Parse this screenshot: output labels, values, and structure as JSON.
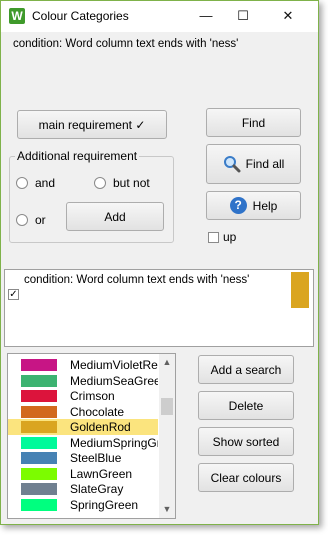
{
  "window": {
    "title": "Colour Categories",
    "app_icon_letter": "W",
    "minimize_glyph": "—",
    "maximize_glyph": "☐",
    "close_glyph": "✕"
  },
  "top_condition": "condition: Word column text ends with 'ness'",
  "buttons": {
    "main_requirement": "main  requirement ✓",
    "find": "Find",
    "find_all": "Find all",
    "help": "Help",
    "add": "Add",
    "add_search": "Add a search",
    "delete": "Delete",
    "show_sorted": "Show sorted",
    "clear_colours": "Clear colours"
  },
  "additional_requirement": {
    "label": "Additional requirement",
    "and": "and",
    "but_not": "but not",
    "or": "or"
  },
  "up_label": "up",
  "search_item": {
    "text": "condition: Word column text ends with 'ness'",
    "checked": true,
    "color": "#DAA520"
  },
  "colours": [
    {
      "name": "MediumVioletRed",
      "color": "#C71585",
      "selected": false
    },
    {
      "name": "MediumSeaGreen",
      "color": "#3CB371",
      "selected": false
    },
    {
      "name": "Crimson",
      "color": "#DC143C",
      "selected": false
    },
    {
      "name": "Chocolate",
      "color": "#D2691E",
      "selected": false
    },
    {
      "name": "GoldenRod",
      "color": "#DAA520",
      "selected": true
    },
    {
      "name": "MediumSpringGreen",
      "color": "#00FA9A",
      "selected": false
    },
    {
      "name": "SteelBlue",
      "color": "#4682B4",
      "selected": false
    },
    {
      "name": "LawnGreen",
      "color": "#7CFC00",
      "selected": false
    },
    {
      "name": "SlateGray",
      "color": "#708090",
      "selected": false
    },
    {
      "name": "SpringGreen",
      "color": "#00FF7F",
      "selected": false
    }
  ],
  "icons": {
    "find_all": "magnifier-icon",
    "help": "question-icon"
  }
}
